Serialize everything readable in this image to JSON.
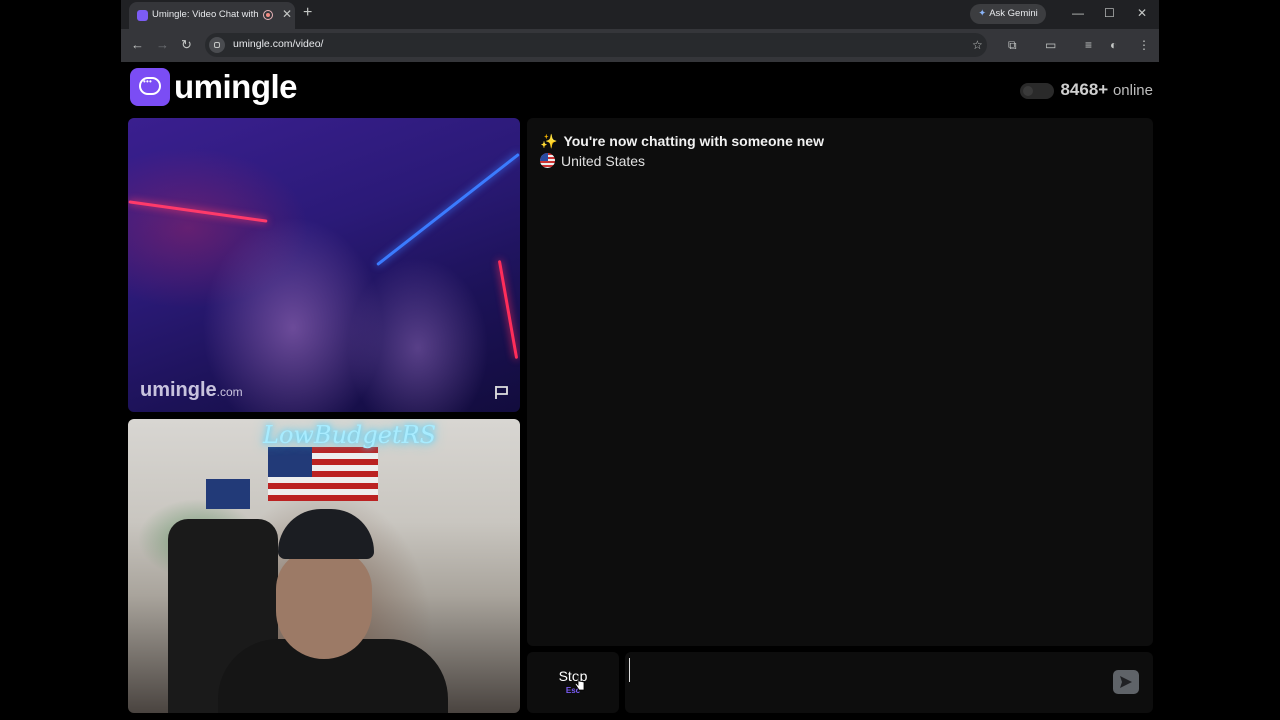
{
  "browser": {
    "tab_title": "Umingle: Video Chat with S",
    "new_tab": "+",
    "ask_gemini": "Ask Gemini",
    "url": "umingle.com/video/",
    "window_controls": {
      "minimize": "—",
      "maximize": "☐",
      "close": "✕"
    }
  },
  "site": {
    "logo_text": "umingle",
    "online_count": "8468+",
    "online_label": "online"
  },
  "stranger_video": {
    "watermark_brand": "umingle",
    "watermark_domain": ".com",
    "report_icon": "flag-icon"
  },
  "self_video": {
    "neon_sign": "LowBudgetRS"
  },
  "chat": {
    "status_message": "You're now chatting with someone new",
    "status_icon": "sparkles-icon",
    "partner_country": "United States",
    "partner_flag_icon": "us-flag-icon"
  },
  "controls": {
    "stop_label": "Stop",
    "stop_shortcut": "Esc",
    "message_value": "",
    "send_icon": "send-icon"
  },
  "colors": {
    "brand_purple": "#7b4df4",
    "background": "#000000",
    "panel": "#0d0d0d"
  }
}
